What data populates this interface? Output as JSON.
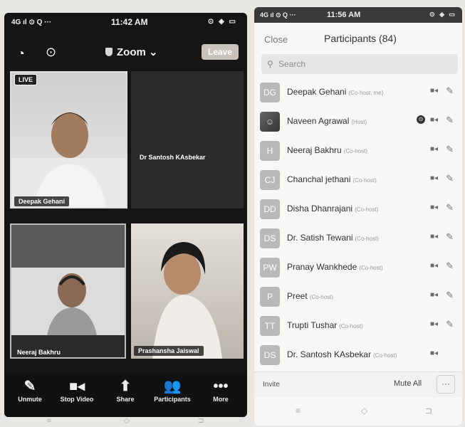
{
  "left": {
    "status": {
      "signal": "4G ıl ⊙ Q ···",
      "time": "11:42 AM",
      "system": "⊙ ◈ ▭"
    },
    "meeting_title": "Zoom",
    "leave_label": "Leave",
    "live_label": "LIVE",
    "tiles": [
      {
        "name": "Deepak Gehani"
      },
      {
        "name": "Dr Santosh KAsbekar"
      },
      {
        "name": "Neeraj Bakhru"
      },
      {
        "name": "Prashansha Jaiswal"
      }
    ],
    "controls": [
      {
        "label": "Unmute",
        "icon": "mic-off-icon"
      },
      {
        "label": "Stop Video",
        "icon": "video-icon"
      },
      {
        "label": "Share",
        "icon": "share-icon"
      },
      {
        "label": "Participants",
        "icon": "participants-icon"
      },
      {
        "label": "More",
        "icon": "more-icon"
      }
    ]
  },
  "right": {
    "status": {
      "signal": "4G ıl ⊙ Q ···",
      "time": "11:56 AM",
      "system": "⊙ ◈ ▭"
    },
    "close_label": "Close",
    "title": "Participants (84)",
    "search_placeholder": "Search",
    "participants": [
      {
        "initials": "DG",
        "name": "Deepak Gehani",
        "role": "(Co-host, me)"
      },
      {
        "initials": "",
        "name": "Naveen Agrawal",
        "role": "(Host)"
      },
      {
        "initials": "H",
        "name": "Neeraj Bakhru",
        "role": "(Co-host)"
      },
      {
        "initials": "CJ",
        "name": "Chanchal jethani",
        "role": "(Co-host)"
      },
      {
        "initials": "DD",
        "name": "Disha Dhanrajani",
        "role": "(Co-host)"
      },
      {
        "initials": "DS",
        "name": "Dr. Satish Tewani",
        "role": "(Co-host)"
      },
      {
        "initials": "PW",
        "name": "Pranay Wankhede",
        "role": "(Co-host)"
      },
      {
        "initials": "P",
        "name": "Preet",
        "role": "(Co-host)"
      },
      {
        "initials": "TT",
        "name": "Trupti Tushar",
        "role": "(Co-host)"
      },
      {
        "initials": "DS",
        "name": "Dr. Santosh KAsbekar",
        "role": "(Co-host)"
      }
    ],
    "invite_label": "Invite",
    "mute_all_label": "Mute All",
    "more_label": "···"
  },
  "nav": {
    "menu": "≡",
    "home": "◇",
    "back": "⊐"
  }
}
